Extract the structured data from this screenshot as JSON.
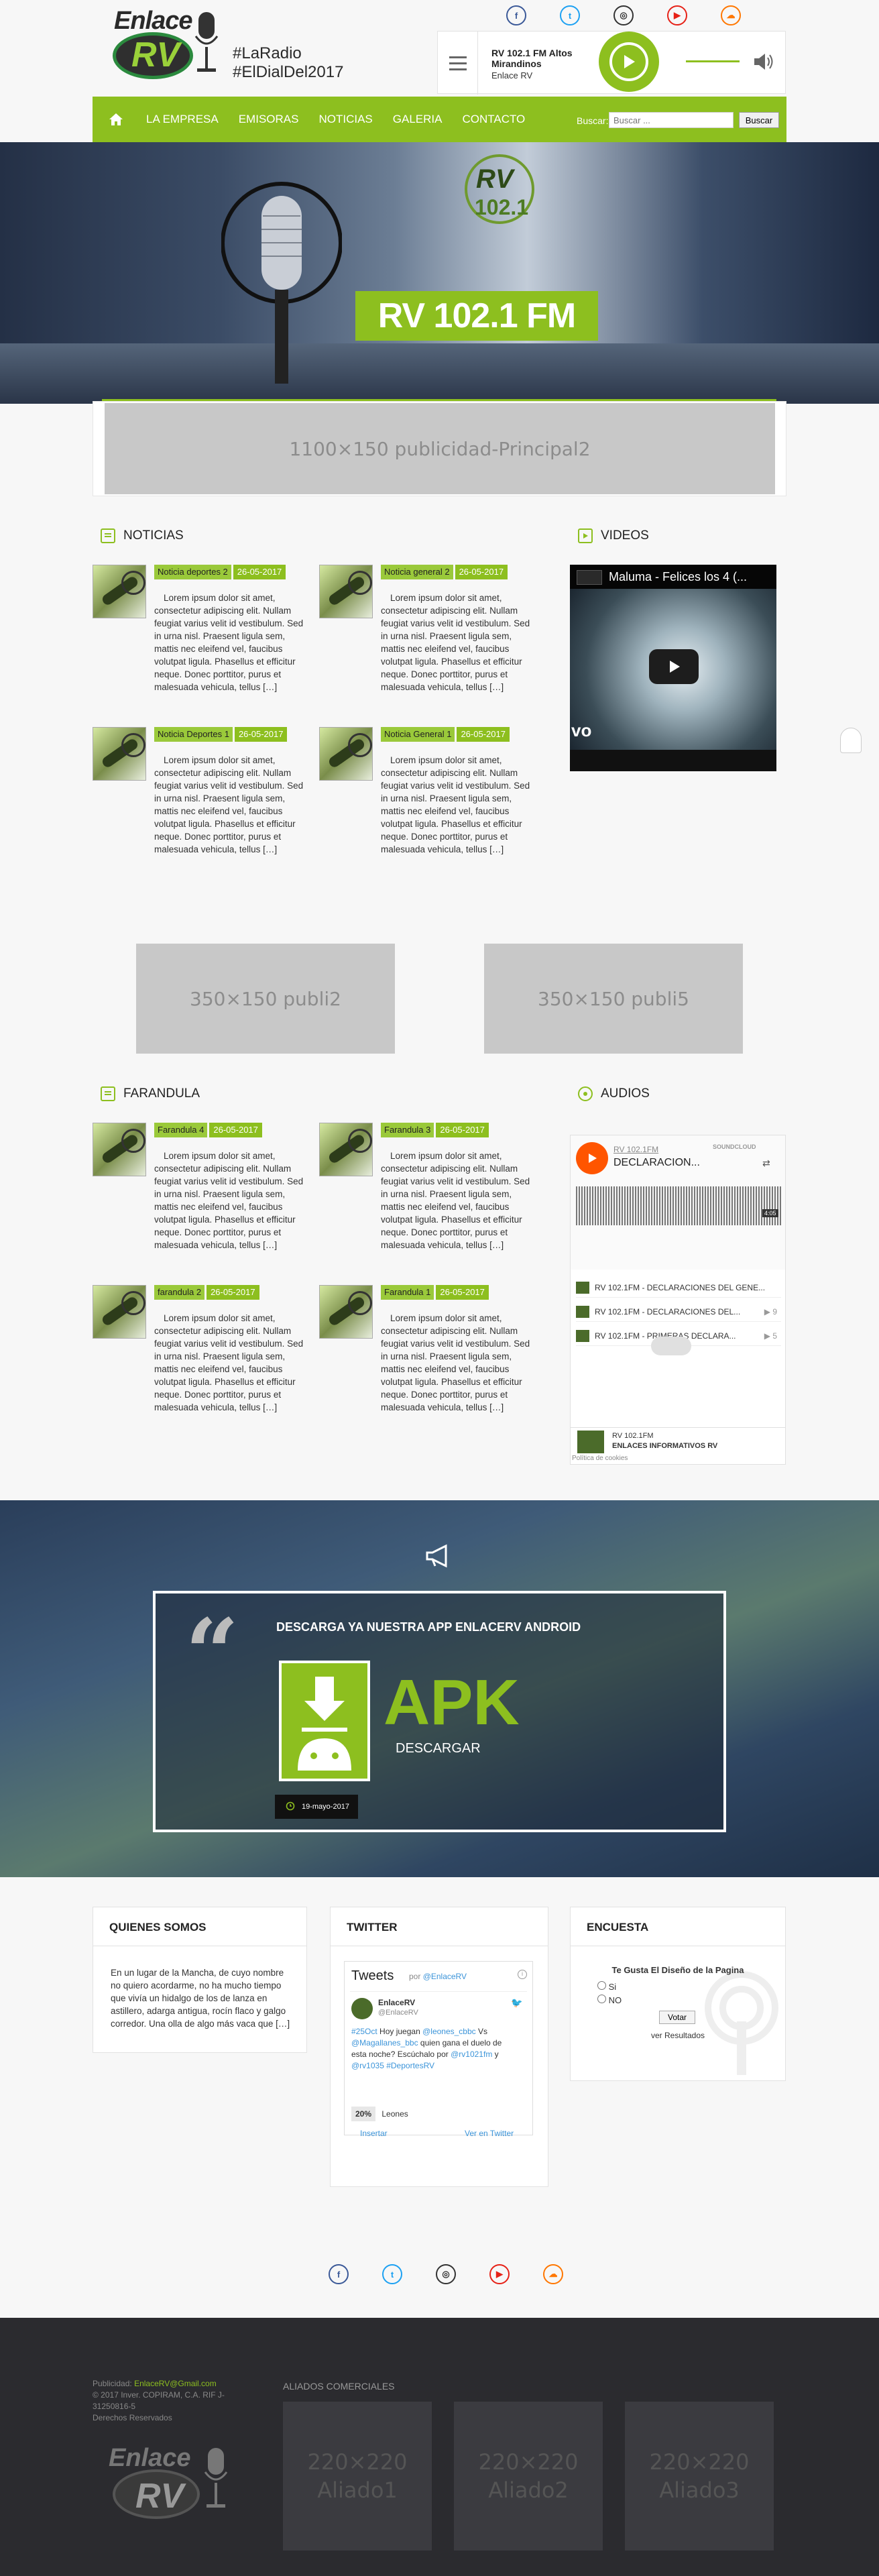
{
  "header": {
    "logo_text_top": "Enlace",
    "logo_text_main": "RV",
    "tagline_1": "#LaRadio",
    "tagline_2": "#ElDialDel2017",
    "social": [
      {
        "name": "facebook-icon",
        "glyph": "f",
        "color": "#3b5998"
      },
      {
        "name": "twitter-icon",
        "glyph": "t",
        "color": "#1da1f2"
      },
      {
        "name": "instagram-icon",
        "glyph": "◎",
        "color": "#333333"
      },
      {
        "name": "youtube-icon",
        "glyph": "▶",
        "color": "#e62117"
      },
      {
        "name": "soundcloud-icon",
        "glyph": "☁",
        "color": "#ff7700"
      }
    ]
  },
  "player": {
    "station": "RV 102.1 FM Altos Mirandinos",
    "subtitle": "Enlace RV"
  },
  "nav": {
    "items": [
      "LA EMPRESA",
      "EMISORAS",
      "NOTICIAS",
      "GALERIA",
      "CONTACTO"
    ],
    "search_label": "Buscar:",
    "search_placeholder": "Buscar ...",
    "search_button": "Buscar"
  },
  "hero": {
    "badge": "RV 102.1 FM",
    "logo_text": "RV",
    "logo_freq": "102.1"
  },
  "ads": {
    "principal": "1100×150 publicidad-Principal2",
    "publi2": "350×150 publi2",
    "publi5": "350×150 publi5"
  },
  "noticias": {
    "title": "NOTICIAS",
    "posts": [
      {
        "tag": "Noticia deportes 2",
        "date": "26-05-2017",
        "text": "Lorem ipsum dolor sit amet, consectetur adipiscing elit. Nullam feugiat varius velit id vestibulum. Sed in urna nisl. Praesent ligula sem, mattis nec eleifend vel, faucibus volutpat ligula. Phasellus et efficitur neque. Donec porttitor, purus et malesuada vehicula, tellus […]"
      },
      {
        "tag": "Noticia general 2",
        "date": "26-05-2017",
        "text": "Lorem ipsum dolor sit amet, consectetur adipiscing elit. Nullam feugiat varius velit id vestibulum. Sed in urna nisl. Praesent ligula sem, mattis nec eleifend vel, faucibus volutpat ligula. Phasellus et efficitur neque. Donec porttitor, purus et malesuada vehicula, tellus […]"
      },
      {
        "tag": "Noticia Deportes 1",
        "date": "26-05-2017",
        "text": "Lorem ipsum dolor sit amet, consectetur adipiscing elit. Nullam feugiat varius velit id vestibulum. Sed in urna nisl. Praesent ligula sem, mattis nec eleifend vel, faucibus volutpat ligula. Phasellus et efficitur neque. Donec porttitor, purus et malesuada vehicula, tellus […]"
      },
      {
        "tag": "Noticia General 1",
        "date": "26-05-2017",
        "text": "Lorem ipsum dolor sit amet, consectetur adipiscing elit. Nullam feugiat varius velit id vestibulum. Sed in urna nisl. Praesent ligula sem, mattis nec eleifend vel, faucibus volutpat ligula. Phasellus et efficitur neque. Donec porttitor, purus et malesuada vehicula, tellus […]"
      }
    ]
  },
  "videos": {
    "title": "VIDEOS",
    "video_title": "Maluma - Felices los 4 (...",
    "watermark": "vo"
  },
  "farandula": {
    "title": "FARANDULA",
    "posts": [
      {
        "tag": "Farandula 4",
        "date": "26-05-2017",
        "text": "Lorem ipsum dolor sit amet, consectetur adipiscing elit. Nullam feugiat varius velit id vestibulum. Sed in urna nisl. Praesent ligula sem, mattis nec eleifend vel, faucibus volutpat ligula. Phasellus et efficitur neque. Donec porttitor, purus et malesuada vehicula, tellus […]"
      },
      {
        "tag": "Farandula 3",
        "date": "26-05-2017",
        "text": "Lorem ipsum dolor sit amet, consectetur adipiscing elit. Nullam feugiat varius velit id vestibulum. Sed in urna nisl. Praesent ligula sem, mattis nec eleifend vel, faucibus volutpat ligula. Phasellus et efficitur neque. Donec porttitor, purus et malesuada vehicula, tellus […]"
      },
      {
        "tag": "farandula 2",
        "date": "26-05-2017",
        "text": "Lorem ipsum dolor sit amet, consectetur adipiscing elit. Nullam feugiat varius velit id vestibulum. Sed in urna nisl. Praesent ligula sem, mattis nec eleifend vel, faucibus volutpat ligula. Phasellus et efficitur neque. Donec porttitor, purus et malesuada vehicula, tellus […]"
      },
      {
        "tag": "Farandula 1",
        "date": "26-05-2017",
        "text": "Lorem ipsum dolor sit amet, consectetur adipiscing elit. Nullam feugiat varius velit id vestibulum. Sed in urna nisl. Praesent ligula sem, mattis nec eleifend vel, faucibus volutpat ligula. Phasellus et efficitur neque. Donec porttitor, purus et malesuada vehicula, tellus […]"
      }
    ]
  },
  "audios": {
    "title": "AUDIOS",
    "brand": "SOUNDCLOUD",
    "artist": "RV 102.1FM",
    "track_title": "DECLARACION...",
    "duration": "4:05",
    "tracks": [
      {
        "title": "RV 102.1FM - DECLARACIONES DEL GENE...",
        "plays": ""
      },
      {
        "title": "RV 102.1FM - DECLARACIONES DEL...",
        "plays": "▶ 9"
      },
      {
        "title": "RV 102.1FM - PRIMERAS DECLARA...",
        "plays": "▶ 5"
      }
    ],
    "footer_name": "RV 102.1FM",
    "footer_sub": "ENLACES INFORMATIVOS RV",
    "cookies": "Política de cookies"
  },
  "app": {
    "title": "DESCARGA YA NUESTRA APP ENLACERV ANDROID",
    "apk": "APK",
    "download": "DESCARGAR",
    "date": "19-mayo-2017"
  },
  "quienes": {
    "title": "QUIENES SOMOS",
    "text": "En un lugar de la Mancha, de cuyo nombre no quiero acordarme, no ha mucho tiempo que vivía un hidalgo de los de lanza en astillero, adarga antigua, rocín flaco y galgo corredor. Una olla de algo más vaca que […]"
  },
  "twitter": {
    "title": "TWITTER",
    "widget_title": "Tweets",
    "by": "por",
    "handle": "@EnlaceRV",
    "user": "EnlaceRV",
    "user_handle": "@EnlaceRV",
    "tweet_pre": "#25Oct",
    "tweet_1": " Hoy juegan ",
    "tweet_m1": "@leones_cbbc",
    "tweet_2": " Vs ",
    "tweet_m2": "@Magallanes_bbc",
    "tweet_3": " quien gana el duelo de esta noche? Escúchalo por ",
    "tweet_m3": "@rv1021fm",
    "tweet_4": " y ",
    "tweet_m4": "@rv1035",
    "tweet_tag": " #DeportesRV",
    "poll_pct": "20%",
    "poll_label": "Leones",
    "embed": "Insertar",
    "view": "Ver en Twitter"
  },
  "encuesta": {
    "title": "ENCUESTA",
    "question": "Te Gusta El Diseño de la Pagina",
    "options": [
      "Si",
      "NO"
    ],
    "vote": "Votar",
    "results": "ver Resultados"
  },
  "footer": {
    "publicidad_label": "Publicidad:",
    "publicidad_email": "EnlaceRV@Gmail.com",
    "copyright": "© 2017 Inver. COPIRAM, C.A. RIF J-31250816-5",
    "rights": "Derechos Reservados",
    "allies_title": "ALIADOS COMERCIALES",
    "allies": [
      "220×220 Aliado1",
      "220×220 Aliado2",
      "220×220 Aliado3"
    ]
  }
}
